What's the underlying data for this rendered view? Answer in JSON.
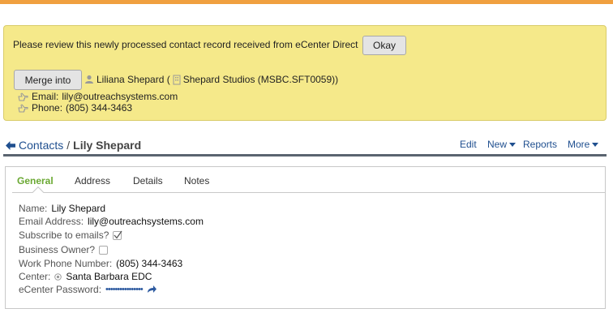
{
  "notice": {
    "message": "Please review this newly processed contact record received from eCenter Direct",
    "okay_label": "Okay",
    "merge_label": "Merge into",
    "merge_person": "Liliana Shepard (",
    "merge_company": "Shepard Studios (MSBC.SFT0059))",
    "email_label": "Email:",
    "email_value": "lily@outreachsystems.com",
    "phone_label": "Phone:",
    "phone_value": "(805) 344-3463"
  },
  "breadcrumb": {
    "parent": "Contacts",
    "separator": "/",
    "current": "Lily Shepard"
  },
  "actions": {
    "edit": "Edit",
    "new": "New",
    "reports": "Reports",
    "more": "More"
  },
  "tabs": [
    {
      "label": "General",
      "active": true
    },
    {
      "label": "Address",
      "active": false
    },
    {
      "label": "Details",
      "active": false
    },
    {
      "label": "Notes",
      "active": false
    }
  ],
  "fields": {
    "name_label": "Name:",
    "name_value": "Lily Shepard",
    "email_label": "Email Address:",
    "email_value": "lily@outreachsystems.com",
    "subscribe_label": "Subscribe to emails?",
    "subscribe_checked": true,
    "owner_label": "Business Owner?",
    "owner_checked": false,
    "work_phone_label": "Work Phone Number:",
    "work_phone_value": "(805) 344-3463",
    "center_label": "Center:",
    "center_value": "Santa Barbara EDC",
    "password_label": "eCenter Password:",
    "password_value": "••••••••••••••••"
  },
  "colors": {
    "accent_orange": "#f0a040",
    "notice_bg": "#f5e98a",
    "link_blue": "#1f4f8f",
    "active_tab_green": "#6aa832"
  },
  "icons": [
    "pointing-hand-icon",
    "user-icon",
    "building-icon",
    "back-arrow-icon",
    "caret-down-icon",
    "checkmark-icon",
    "target-icon",
    "share-arrow-icon"
  ]
}
